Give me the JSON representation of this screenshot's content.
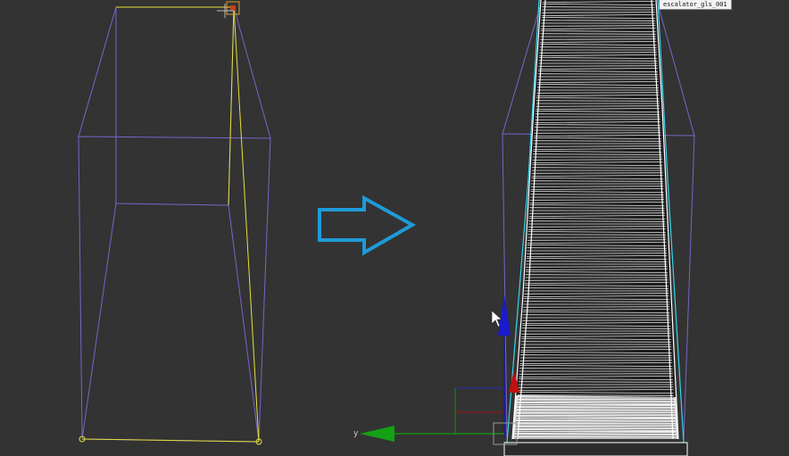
{
  "viewport": {
    "background": "#333333",
    "object_label": "escalator_gls_001",
    "axis_y_label": "y"
  },
  "colors": {
    "wire_purple": "#7a64c8",
    "spline_yellow": "#e6e040",
    "selection_cyan": "#39d3ee",
    "arrow_blue": "#1e9bd8",
    "axis_blue": "#1010c0",
    "axis_green": "#14a014",
    "axis_red": "#c01010",
    "mesh_white": "#ffffff",
    "mesh_dark": "#1e1e1e"
  },
  "icons": [
    "arrow-right-icon",
    "mouse-cursor-icon",
    "gizmo-z-arrow-icon",
    "gizmo-y-arrow-icon",
    "gizmo-x-arrow-icon",
    "vertex-handle-icon"
  ]
}
